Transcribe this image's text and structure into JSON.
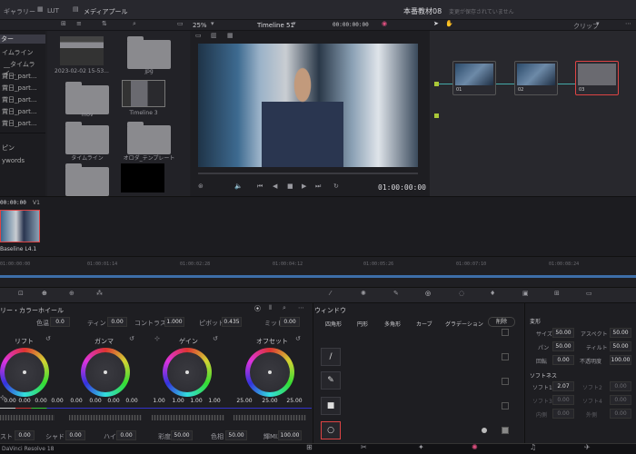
{
  "top_tabs": {
    "gallery": "ギャラリー",
    "lut": "LUT",
    "media_pool": "メディアプール"
  },
  "project": {
    "title": "本番教材08",
    "status": "変更が保存されていません"
  },
  "left_tree": [
    "ター",
    "イムライン",
    "__タイムライ...",
    "賞日_part...",
    "賞日_part...",
    "賞日_part...",
    "賞日_part...",
    "賞日_part..."
  ],
  "left_tree2": [
    "ピン",
    "ywords"
  ],
  "media": [
    {
      "label": "2023-02-02 15-53...",
      "kind": "video"
    },
    {
      "label": "jpg",
      "kind": "folder"
    },
    {
      "label": "mov",
      "kind": "folder"
    },
    {
      "label": "Timeline 3",
      "kind": "timeline"
    },
    {
      "label": "タイムライン",
      "kind": "folder"
    },
    {
      "label": "オロダ_テンプレート",
      "kind": "folder"
    },
    {
      "label": "",
      "kind": "black"
    }
  ],
  "viewer": {
    "zoom": "25%",
    "timeline_name": "Timeline 51",
    "timecode_top": "00:00:00:00",
    "timecode": "01:00:00:00"
  },
  "clip_mode": "クリップ",
  "nodes": [
    {
      "num": "01"
    },
    {
      "num": "02"
    },
    {
      "num": "03"
    }
  ],
  "clip_strip": {
    "timecode": "00:00:00",
    "track": "V1",
    "clip_name": "Baseline L4.1"
  },
  "ruler": [
    "01:00:00:00",
    "01:00:01:14",
    "01:00:02:28",
    "01:00:04:12",
    "01:00:05:26",
    "01:00:07:10",
    "01:00:08:24"
  ],
  "color_panel": {
    "title": "リー・カラーホイール",
    "params": {
      "color_boost_label": "色温",
      "color_boost": "0.0",
      "tint_label": "ティント",
      "tint": "0.00",
      "contrast_label": "コントラスト",
      "contrast": "1.000",
      "pivot_label": "ピボット",
      "pivot": "0.435",
      "mid_label": "ミッド",
      "mid": "0.00"
    }
  },
  "wheels": [
    {
      "label": "リフト",
      "values": [
        "0.00",
        "0.00",
        "0.00",
        "0.00"
      ]
    },
    {
      "label": "ガンマ",
      "values": [
        "0.00",
        "0.00",
        "0.00",
        "0.00"
      ]
    },
    {
      "label": "ゲイン",
      "values": [
        "1.00",
        "1.00",
        "1.00",
        "1.00"
      ]
    },
    {
      "label": "オフセット",
      "values": [
        "25.00",
        "25.00",
        "25.00"
      ]
    }
  ],
  "bottom_params": {
    "p1l": "スト",
    "p1": "0.00",
    "p2l": "シャド",
    "p2": "0.00",
    "p3l": "ハイ",
    "p3": "0.00",
    "p4l": "彩度",
    "p4": "50.00",
    "p5l": "色相",
    "p5": "50.00",
    "p6l": "輝MIX",
    "p6": "100.00"
  },
  "window_panel": {
    "title": "ウィンドウ",
    "tools": [
      "四角形",
      "円形",
      "多角形",
      "カーブ",
      "グラデーション"
    ],
    "delete": "削除"
  },
  "transform": {
    "title": "変形",
    "size_l": "サイズ",
    "size": "50.00",
    "aspect_l": "アスペクト",
    "aspect": "50.00",
    "pan_l": "パン",
    "pan": "50.00",
    "tilt_l": "ティルト",
    "tilt": "50.00",
    "rot_l": "回転",
    "rot": "0.00",
    "opacity_l": "不透明度",
    "opacity": "100.00"
  },
  "softness": {
    "title": "ソフトネス",
    "s1l": "ソフト1",
    "s1": "2.07",
    "s2l": "ソフト2",
    "s2": "0.00",
    "s3l": "ソフト3",
    "s3": "0.00",
    "s4l": "ソフト4",
    "s4": "0.00",
    "inl": "内側",
    "in": "0.00",
    "outl": "外側",
    "out": "0.00"
  },
  "app": {
    "name": "DaVinci Resolve 18"
  }
}
